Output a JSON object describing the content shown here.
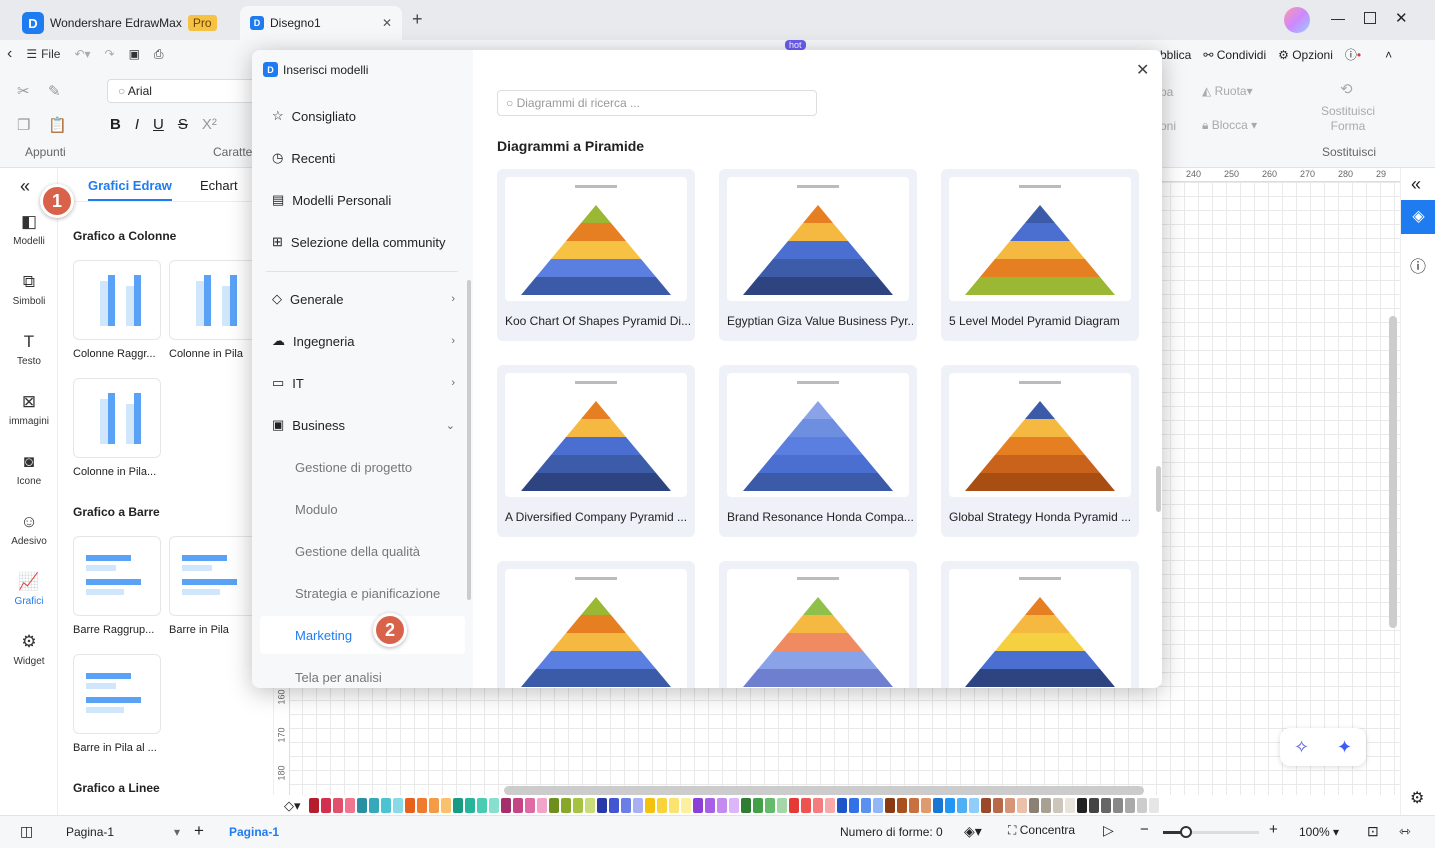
{
  "app": {
    "name": "Wondershare EdrawMax",
    "badge": "Pro",
    "doc_tab": "Disegno1",
    "logo_letter": "D"
  },
  "toolbar": {
    "file": "File",
    "publish": "bblica",
    "share": "Condividi",
    "options": "Opzioni",
    "hot": "hot"
  },
  "ribbon": {
    "font": "Arial",
    "clipboard": "Appunti",
    "font_group": "Caratte",
    "rotate": "Ruota",
    "lock": "Blocca",
    "replace_shape": "Sostituisci Forma",
    "replace_group": "Sostituisci",
    "partial1": "pa",
    "partial2": "oni"
  },
  "sidebar": [
    {
      "label": "Modelli",
      "icon": "template-icon"
    },
    {
      "label": "Simboli",
      "icon": "symbols-icon"
    },
    {
      "label": "Testo",
      "icon": "text-icon"
    },
    {
      "label": "immagini",
      "icon": "image-icon"
    },
    {
      "label": "Icone",
      "icon": "icons-icon"
    },
    {
      "label": "Adesivo",
      "icon": "sticker-icon"
    },
    {
      "label": "Grafici",
      "icon": "chart-icon"
    },
    {
      "label": "Widget",
      "icon": "widget-icon"
    }
  ],
  "panel": {
    "tabs": [
      "Grafici Edraw",
      "Echart"
    ],
    "sections": [
      "Grafico a Colonne",
      "Grafico a Barre",
      "Grafico a Linee"
    ],
    "column_items": [
      "Colonne Raggr...",
      "Colonne in Pila",
      "Colonne in Pila..."
    ],
    "bar_items": [
      "Barre Raggrup...",
      "Barre in Pila",
      "Barre in Pila al ..."
    ]
  },
  "ruler": [
    "240",
    "250",
    "260",
    "270",
    "280",
    "29"
  ],
  "vruler": [
    "160",
    "170",
    "180"
  ],
  "modal": {
    "title": "Inserisci modelli",
    "search_placeholder": "Diagrammi di ricerca ...",
    "heading": "Diagrammi a Piramide",
    "nav": [
      {
        "label": "Consigliato"
      },
      {
        "label": "Recenti"
      },
      {
        "label": "Modelli Personali"
      },
      {
        "label": "Selezione della community"
      },
      {
        "label": "Generale"
      },
      {
        "label": "Ingegneria"
      },
      {
        "label": "IT"
      },
      {
        "label": "Business"
      }
    ],
    "business_sub": [
      "Gestione di progetto",
      "Modulo",
      "Gestione della qualità",
      "Strategia e pianificazione",
      "Marketing",
      "Tela per analisi"
    ],
    "templates": [
      "Koo Chart Of Shapes Pyramid Di...",
      "Egyptian Giza Value Business Pyr...",
      "5 Level Model Pyramid Diagram",
      "A Diversified Company Pyramid ...",
      "Brand Resonance Honda Compa...",
      "Global Strategy Honda Pyramid ...",
      "",
      "",
      ""
    ]
  },
  "badges": [
    "1",
    "2"
  ],
  "status": {
    "page_select": "Pagina-1",
    "page_tab": "Pagina-1",
    "shape_count": "Numero di forme: 0",
    "focus": "Concentra",
    "zoom": "100%",
    "zoom_level": 0.5
  },
  "colors": {
    "accent": "#1f7cf0",
    "badge": "#d9634a"
  },
  "palette": [
    "#b71c2c",
    "#d32f4f",
    "#e0506a",
    "#f07590",
    "#2a8fa0",
    "#35a9bb",
    "#4cc3d2",
    "#8ad9e6",
    "#e8601c",
    "#f07a2e",
    "#f59a45",
    "#f8c16a",
    "#1a9a80",
    "#26b59a",
    "#48cdb3",
    "#86e0cd",
    "#a3306a",
    "#c44486",
    "#df6aa5",
    "#f2a3c8",
    "#6e8f1e",
    "#88a82a",
    "#a5c240",
    "#c8dc7a",
    "#283aa6",
    "#4256d1",
    "#6b7de6",
    "#a6b0f2",
    "#f4c20d",
    "#f8d33b",
    "#fae36e",
    "#fcef9e",
    "#8e3fd6",
    "#a95ee6",
    "#c48af0",
    "#dcb6f7",
    "#2e7d32",
    "#43a047",
    "#66bb6a",
    "#a5d6a7",
    "#e53935",
    "#ef5350",
    "#f47c7c",
    "#f8aaaa",
    "#1d56c9",
    "#3272e6",
    "#5a90f0",
    "#93b6f6",
    "#8a3a12",
    "#a8501f",
    "#c87040",
    "#e09a70",
    "#1976d2",
    "#2196f3",
    "#4fb0f5",
    "#90cdf9",
    "#9a4a2a",
    "#b86a48",
    "#d69478",
    "#ecbfa8",
    "#8a8074",
    "#a9a094",
    "#cbc5bb",
    "#e8e4dc",
    "#222222",
    "#444444",
    "#666666",
    "#888888",
    "#aaaaaa",
    "#cccccc",
    "#e6e6e6",
    "#ffffff"
  ]
}
